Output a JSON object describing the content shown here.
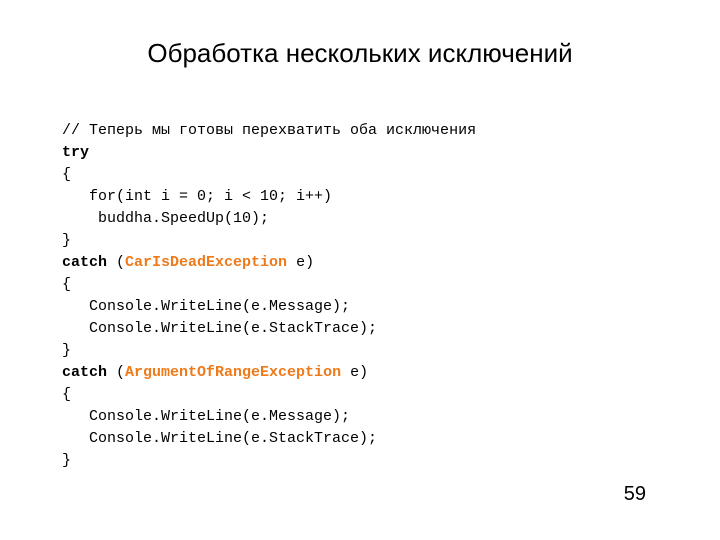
{
  "title": "Обработка нескольких исключений",
  "pageNumber": "59",
  "code": {
    "l1": "// Теперь мы готовы перехватить оба исключения",
    "l2_kw": "try",
    "l3": "{",
    "l4": "   for(int i = 0; i < 10; i++)",
    "l5": "    buddha.SpeedUp(10);",
    "l6": "}",
    "l7_kw": "catch",
    "l7_open": " (",
    "l7_ex": "CarIsDeadException",
    "l7_rest": " e)",
    "l8": "{",
    "l9": "   Console.WriteLine(e.Message);",
    "l10": "   Console.WriteLine(e.StackTrace);",
    "l11": "}",
    "l12_kw": "catch",
    "l12_open": " (",
    "l12_ex": "ArgumentOfRangeException",
    "l12_rest": " e)",
    "l13": "{",
    "l14": "   Console.WriteLine(e.Message);",
    "l15": "   Console.WriteLine(e.StackTrace);",
    "l16": "}"
  }
}
